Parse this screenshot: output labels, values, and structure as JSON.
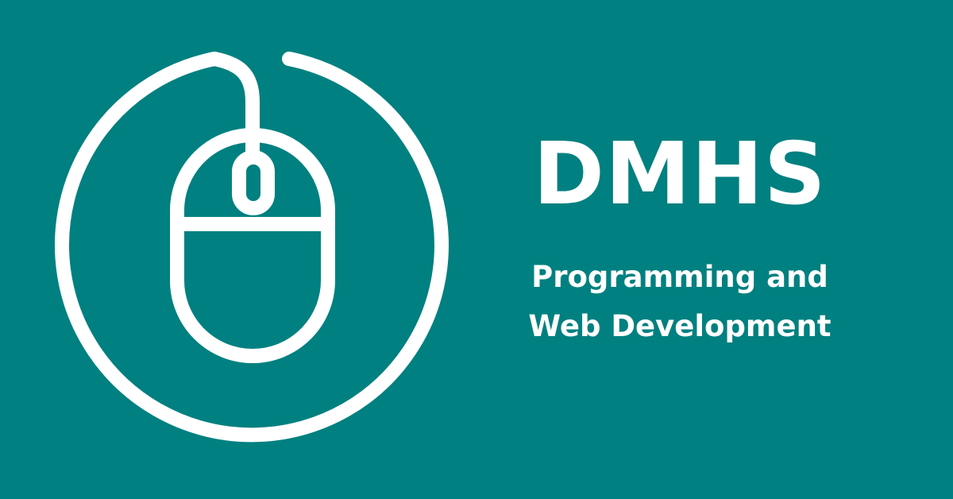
{
  "brand": {
    "title": "DMHS",
    "subtitle_line1": "Programming and",
    "subtitle_line2": "Web Development"
  },
  "icon": {
    "name": "mouse-icon"
  },
  "colors": {
    "background": "#008080",
    "foreground": "#ffffff"
  }
}
